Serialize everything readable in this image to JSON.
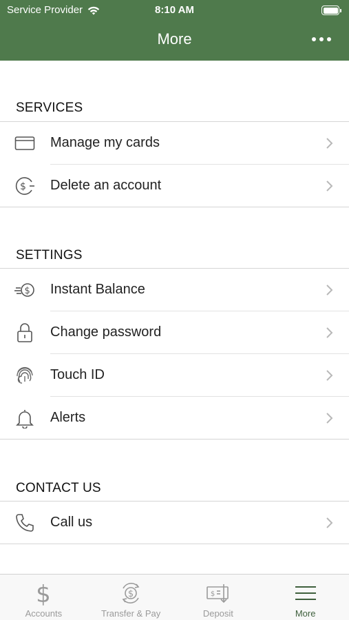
{
  "status_bar": {
    "carrier": "Service Provider",
    "time": "8:10 AM"
  },
  "header": {
    "title": "More"
  },
  "sections": [
    {
      "title": "SERVICES",
      "items": [
        {
          "label": "Manage my cards",
          "icon": "card-icon"
        },
        {
          "label": "Delete an account",
          "icon": "dollar-circle-icon"
        }
      ]
    },
    {
      "title": "SETTINGS",
      "items": [
        {
          "label": "Instant Balance",
          "icon": "instant-balance-icon"
        },
        {
          "label": "Change password",
          "icon": "lock-icon"
        },
        {
          "label": "Touch ID",
          "icon": "fingerprint-icon"
        },
        {
          "label": "Alerts",
          "icon": "bell-icon"
        }
      ]
    },
    {
      "title": "CONTACT US",
      "items": [
        {
          "label": "Call us",
          "icon": "phone-icon"
        }
      ]
    }
  ],
  "tabbar": {
    "tabs": [
      {
        "label": "Accounts",
        "icon": "dollar-icon",
        "active": false
      },
      {
        "label": "Transfer & Pay",
        "icon": "transfer-icon",
        "active": false
      },
      {
        "label": "Deposit",
        "icon": "deposit-check-icon",
        "active": false
      },
      {
        "label": "More",
        "icon": "menu-icon",
        "active": true
      }
    ]
  },
  "colors": {
    "header_bg": "#4f7a4c",
    "active_tab": "#3e5f3c",
    "inactive_tab": "#9a9a9a"
  }
}
